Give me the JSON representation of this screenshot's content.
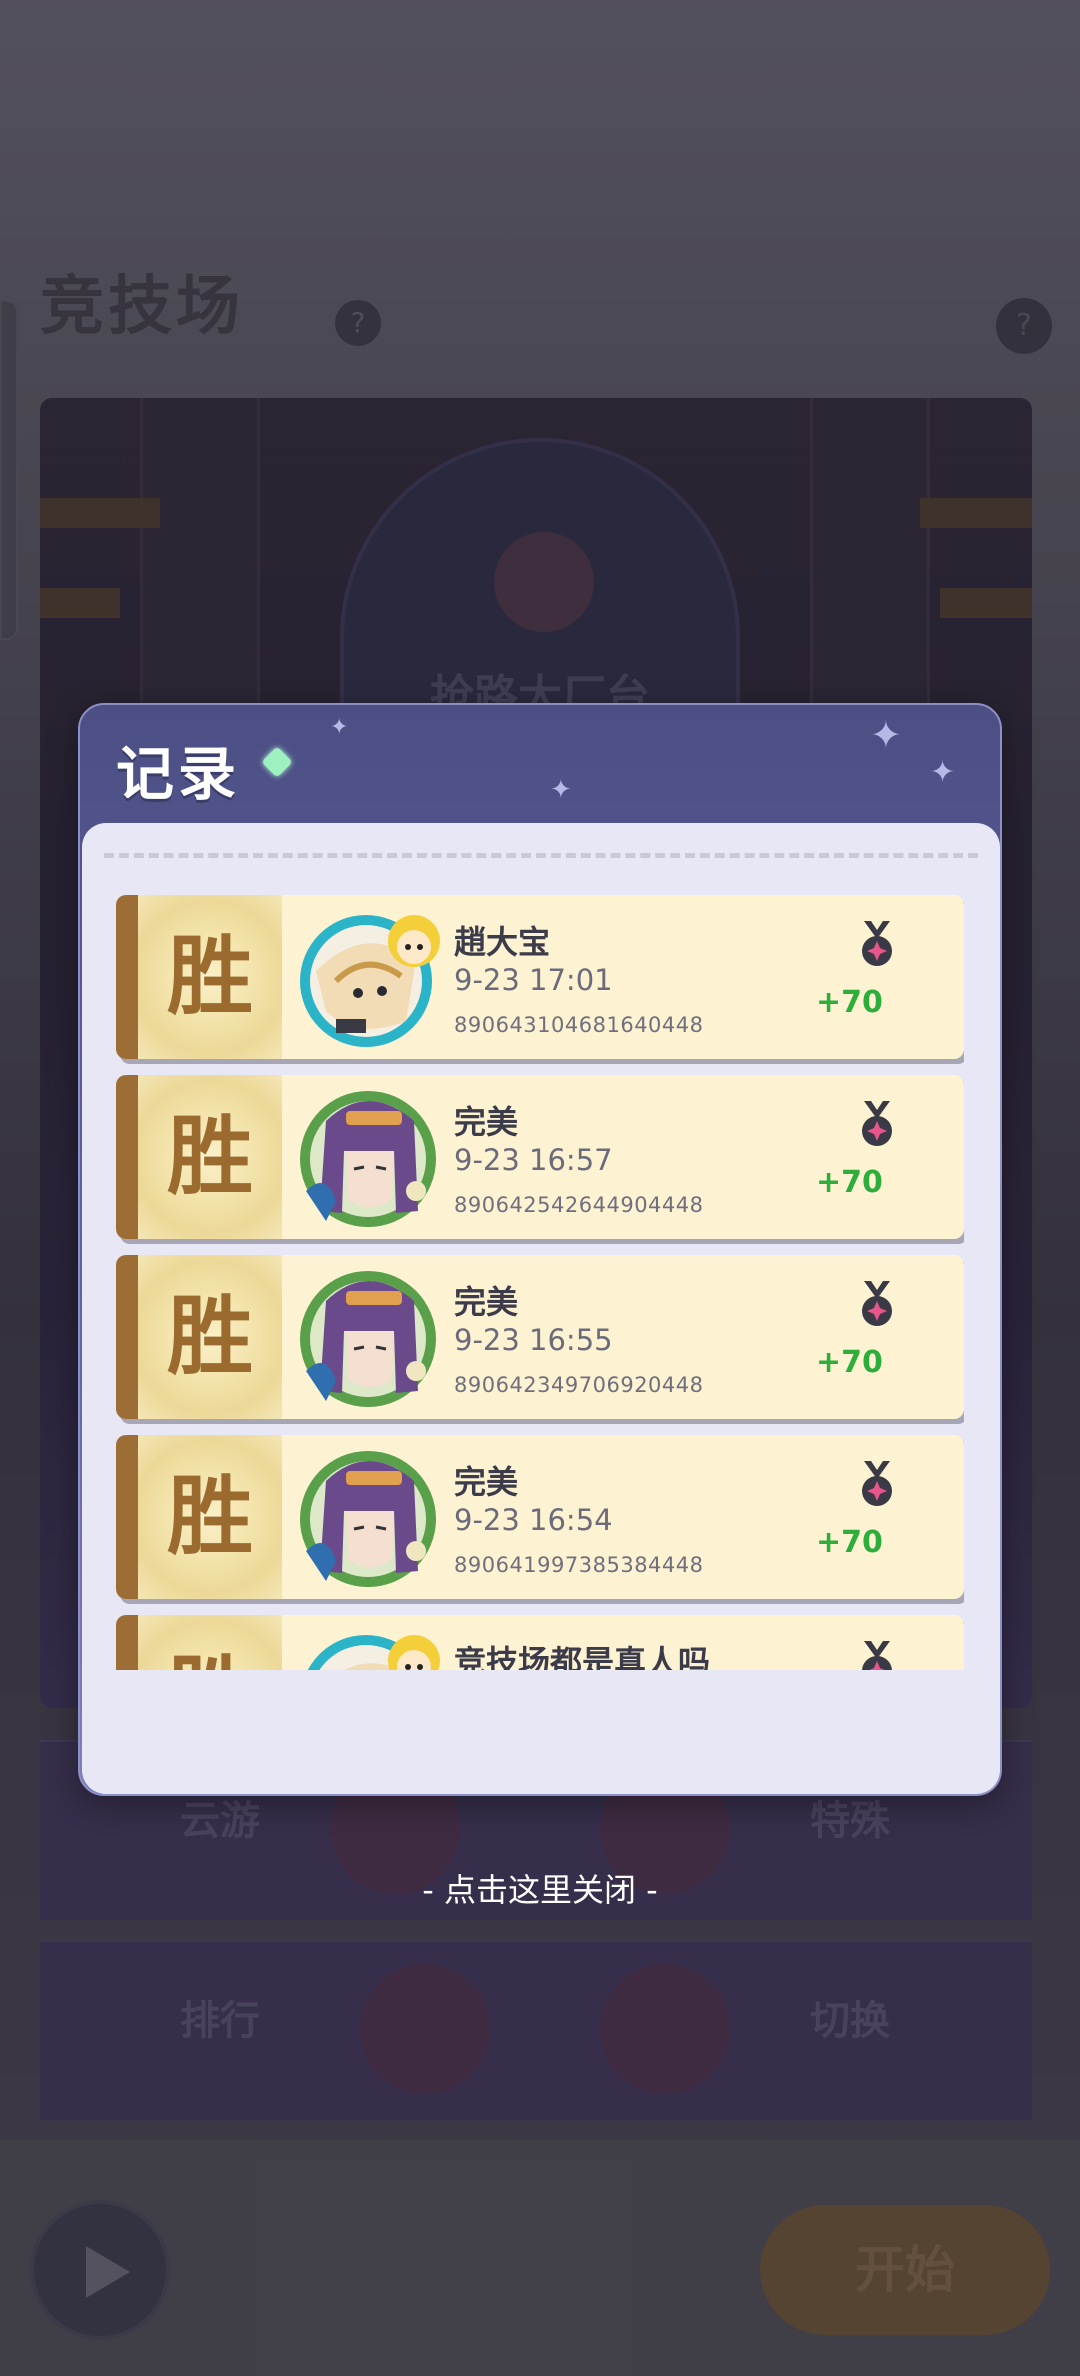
{
  "background": {
    "title": "竞技场",
    "help_glyph": "?",
    "gate_label": "抢路大厂台",
    "buttons_row1": [
      "云游",
      "特殊"
    ],
    "buttons_row2": [
      "排行",
      "切换"
    ],
    "match_button": "开始"
  },
  "dialog": {
    "title": "记录",
    "records": [
      {
        "result": "胜",
        "avatar": "cat-girl-avatar",
        "name": "趙大宝",
        "time": "9-23 17:01",
        "id": "890643104681640448",
        "points": "+70"
      },
      {
        "result": "胜",
        "avatar": "purple-hair-avatar",
        "name": "完美",
        "time": "9-23 16:57",
        "id": "890642542644904448",
        "points": "+70"
      },
      {
        "result": "胜",
        "avatar": "purple-hair-avatar",
        "name": "完美",
        "time": "9-23 16:55",
        "id": "890642349706920448",
        "points": "+70"
      },
      {
        "result": "胜",
        "avatar": "purple-hair-avatar",
        "name": "完美",
        "time": "9-23 16:54",
        "id": "890641997385384448",
        "points": "+70"
      },
      {
        "result": "胜",
        "avatar": "cat-girl-avatar",
        "name": "竞技场都是真人吗",
        "time": "",
        "id": "",
        "points": ""
      }
    ]
  },
  "close_hint": "- 点击这里关闭 -",
  "colors": {
    "win_text": "#9a6a2e",
    "points": "#2dae3a",
    "card_bg": "#fdf3d2",
    "dialog_header": "#4b4f84"
  }
}
